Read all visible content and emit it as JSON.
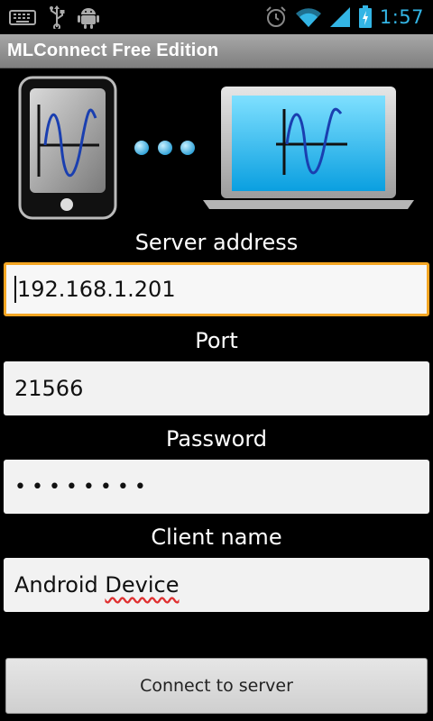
{
  "status_bar": {
    "time": "1:57",
    "left_icons": [
      "keyboard-icon",
      "usb-icon",
      "android-debug-icon"
    ],
    "right_icons": [
      "alarm-icon",
      "wifi-icon",
      "signal-icon",
      "battery-icon"
    ],
    "accent_color": "#33b5e5"
  },
  "app": {
    "title": "MLConnect Free Edition"
  },
  "form": {
    "server_address": {
      "label": "Server address",
      "value": "192.168.1.201"
    },
    "port": {
      "label": "Port",
      "value": "21566"
    },
    "password": {
      "label": "Password",
      "value": "••••••••"
    },
    "client_name": {
      "label": "Client name",
      "value_prefix": "Android ",
      "value_flagged": "Device"
    }
  },
  "connect_button": {
    "label": "Connect to server"
  },
  "colors": {
    "focus_border": "#f5a623",
    "field_background": "#f2f2f2",
    "spellcheck": "#e03030"
  }
}
